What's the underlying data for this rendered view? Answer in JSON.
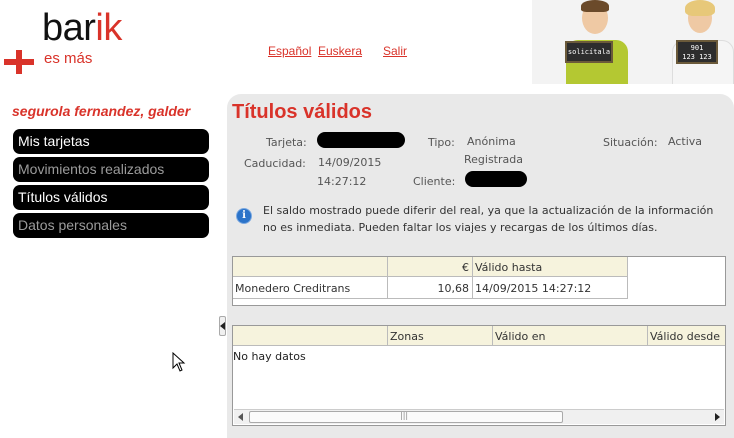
{
  "header": {
    "logo_main_a": "bar",
    "logo_main_b": "ik",
    "logo_tagline": "es más",
    "links": {
      "espanol": "Español",
      "euskera": "Euskera",
      "salir": "Salir"
    },
    "hero_board_1": "solicítala",
    "hero_board_2_l1": "901",
    "hero_board_2_l2": "123 123"
  },
  "colors": {
    "accent": "#d9332a",
    "menu_bg": "#000000",
    "panel_bg": "#e9e9e9",
    "grid_header": "#f6f3dd",
    "info": "#2b73c9"
  },
  "sidebar": {
    "user_name": "segurola fernandez, galder",
    "items": [
      {
        "label": "Mis tarjetas"
      },
      {
        "label": "Movimientos realizados"
      },
      {
        "label": "Títulos válidos"
      },
      {
        "label": "Datos personales"
      }
    ]
  },
  "main": {
    "title": "Títulos válidos",
    "fields": {
      "tarjeta_label": "Tarjeta:",
      "tipo_label": "Tipo:",
      "tipo_value_1": "Anónima",
      "tipo_value_2": "Registrada",
      "situacion_label": "Situación:",
      "situacion_value": "Activa",
      "caducidad_label": "Caducidad:",
      "caducidad_date": "14/09/2015",
      "caducidad_time": "14:27:12",
      "cliente_label": "Cliente:"
    },
    "info_icon": "info-icon",
    "info_message": "El saldo mostrado puede diferir del real, ya que la actualización de la información no es inmediata. Pueden faltar los viajes y recargas de los últimos días.",
    "balance_table": {
      "columns": [
        "",
        "€",
        "Válido hasta"
      ],
      "rows": [
        {
          "name": "Monedero Creditrans",
          "amount": "10,68",
          "valid_until": "14/09/2015 14:27:12"
        }
      ]
    },
    "titles_table": {
      "columns": [
        "",
        "Zonas",
        "Válido en",
        "Válido desde"
      ],
      "empty_text": "No hay datos"
    }
  }
}
